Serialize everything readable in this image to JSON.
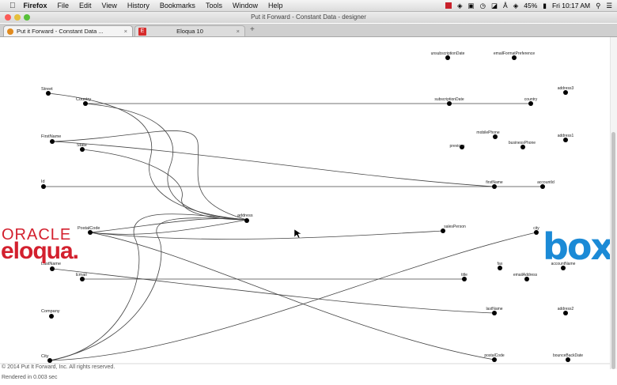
{
  "menubar": {
    "apple": "",
    "app": "Firefox",
    "menus": [
      "File",
      "Edit",
      "View",
      "History",
      "Bookmarks",
      "Tools",
      "Window",
      "Help"
    ],
    "battery": "45%",
    "clock": "Fri 10:17 AM"
  },
  "window": {
    "title": "Put it Forward - Constant Data - designer"
  },
  "tabs": [
    {
      "label": "Put it Forward - Constant Data ...",
      "close": "×"
    },
    {
      "label": "Eloqua 10",
      "close": "×"
    }
  ],
  "newtab": "+",
  "logos": {
    "left_top": "ORACLE",
    "left_bottom": "eloqua.",
    "right": "box",
    "right_color": "#1b8ad6",
    "left_color": "#d3202e"
  },
  "left_fields": [
    "Street",
    "Country",
    "FirstName",
    "State",
    "Id",
    "PostalCode",
    "LastName",
    "Email",
    "Company",
    "City"
  ],
  "middle_fields": [
    "address"
  ],
  "right_fields": [
    "unsubscriptionDate",
    "emailFormatPreference",
    "address3",
    "subscriptionDate",
    "country",
    "mobilePhone",
    "address1",
    "previous",
    "businessPhone",
    "firstName",
    "accountId",
    "salesPerson",
    "city",
    "fax",
    "accountName",
    "title",
    "emailAddress",
    "lastName",
    "address2",
    "postalCode",
    "bounceBackDate"
  ],
  "footer": {
    "copyright": "© 2014 Put It Forward, Inc. All rights reserved.",
    "rendered": "Rendered in 0.003 sec"
  }
}
